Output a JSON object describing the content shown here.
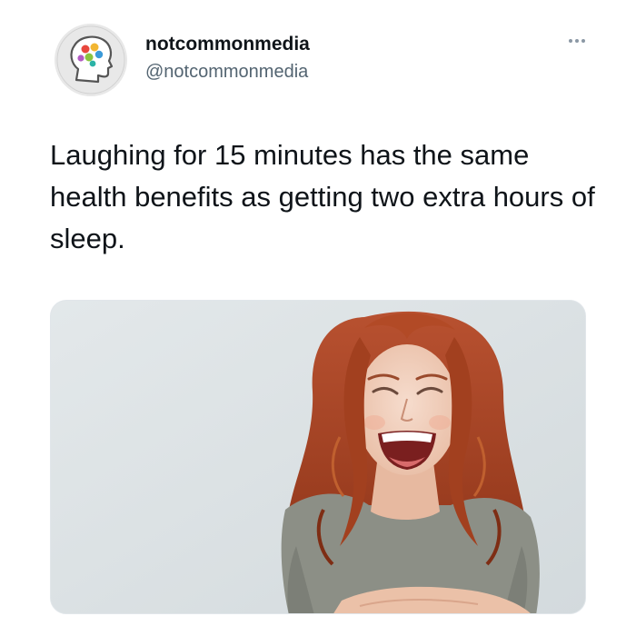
{
  "author": {
    "display_name": "notcommonmedia",
    "handle": "@notcommonmedia",
    "avatar_icon": "head-profile-logo-icon"
  },
  "menu": {
    "icon": "more-options-icon"
  },
  "tweet": {
    "text": "Laughing for 15 minutes has the same health benefits as getting two extra hours of sleep."
  },
  "colors": {
    "text_primary": "#0f1419",
    "text_secondary": "#536471",
    "photo_background": "#dde3e6",
    "hair": "#b04a26",
    "shirt": "#8c8f86"
  }
}
